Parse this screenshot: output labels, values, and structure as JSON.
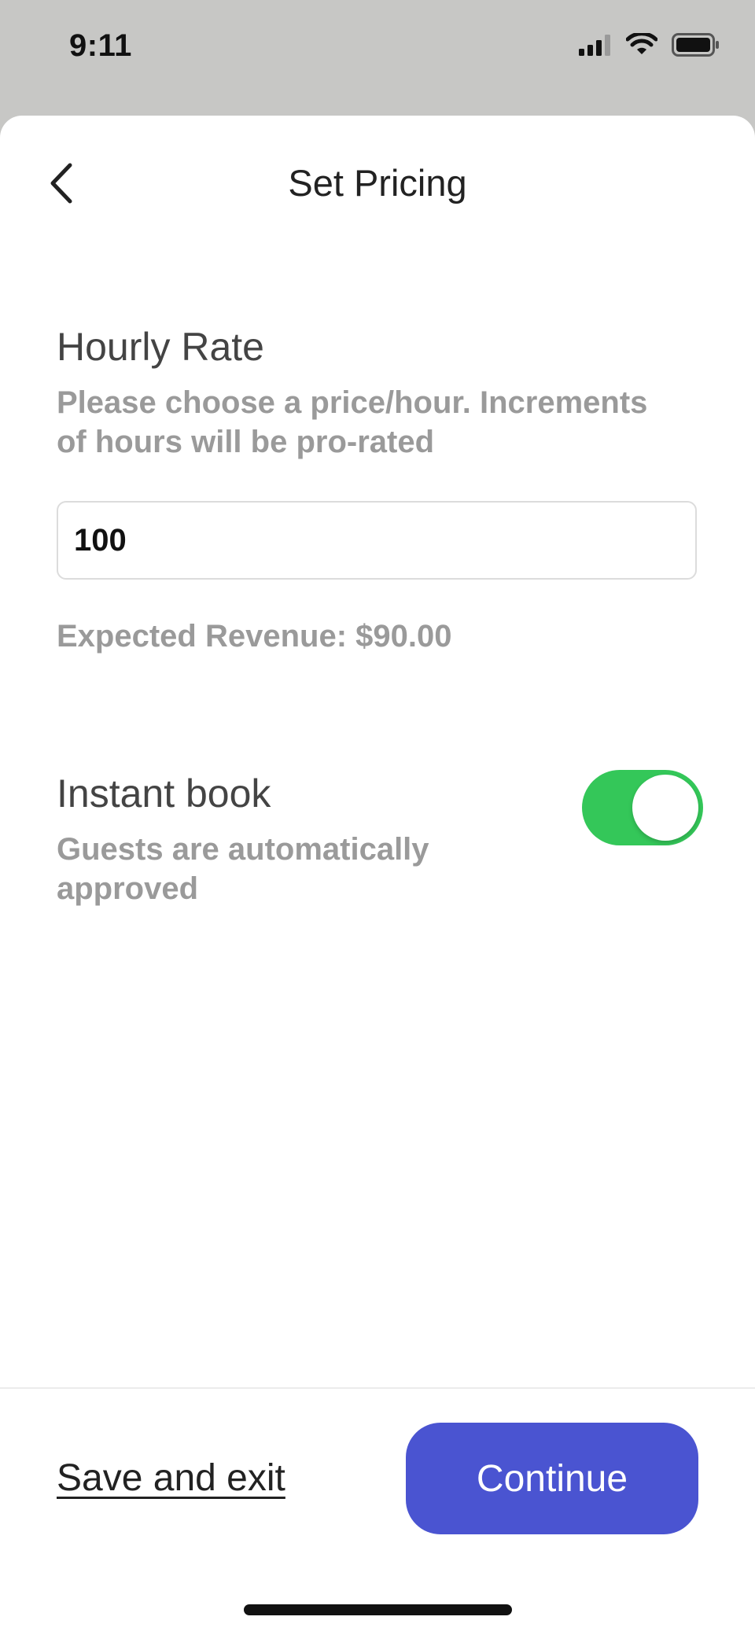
{
  "status_bar": {
    "time": "9:11",
    "icons": [
      "cellular-signal-icon",
      "wifi-icon",
      "battery-icon"
    ]
  },
  "nav": {
    "back_icon": "chevron-left-icon",
    "title": "Set Pricing"
  },
  "hourly_rate": {
    "title": "Hourly Rate",
    "description_line1": "Please choose a price/hour. Increments",
    "description_line2": "of hours will be pro-rated",
    "input_value": "100",
    "expected_revenue": "Expected Revenue: $90.00"
  },
  "instant_book": {
    "title": "Instant book",
    "description_line1": "Guests are automatically",
    "description_line2": "approved",
    "enabled": true,
    "toggle_color": "#34c759"
  },
  "footer": {
    "save_exit_label": "Save and exit",
    "continue_label": "Continue",
    "continue_color": "#4a54d1"
  }
}
